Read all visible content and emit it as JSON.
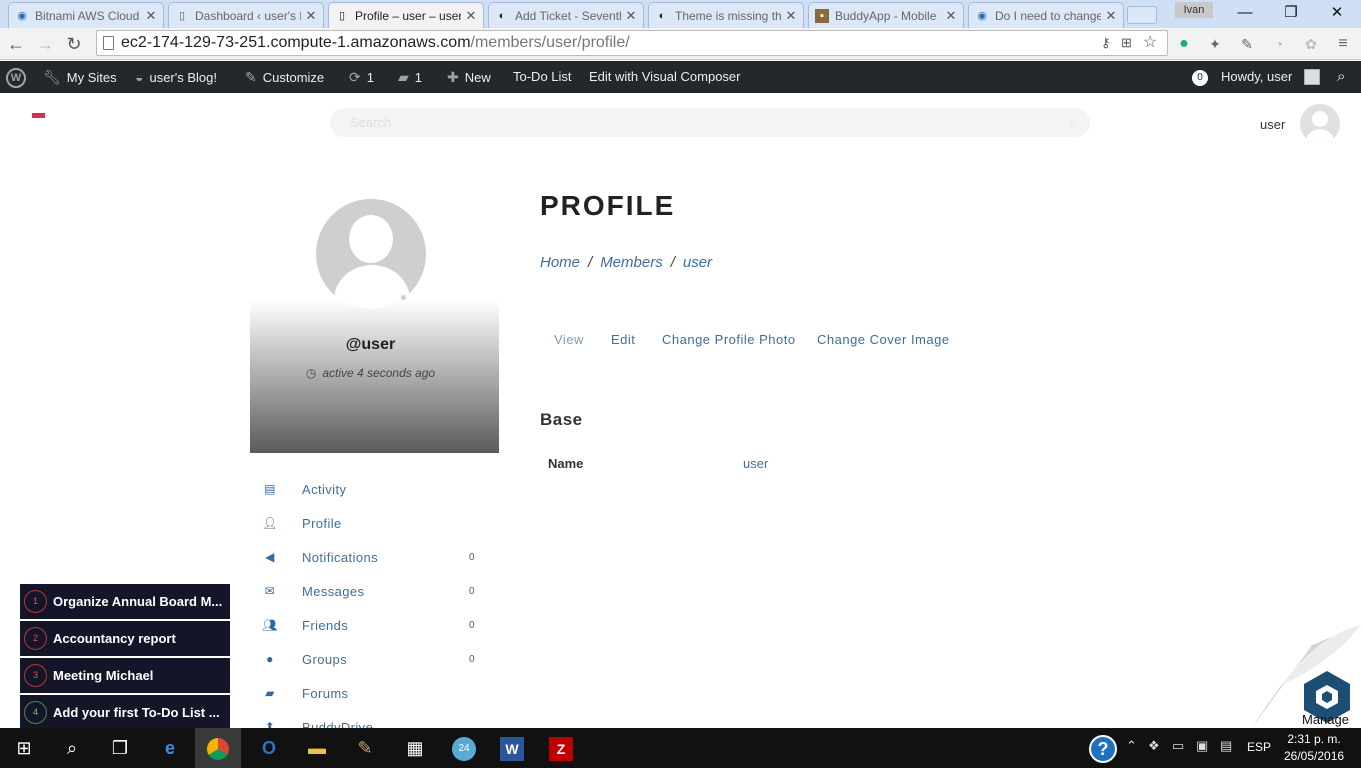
{
  "browser": {
    "tabs": [
      {
        "title": "Bitnami AWS Cloud",
        "icon": "bitnami-icon",
        "active": false
      },
      {
        "title": "Dashboard ‹ user's B",
        "icon": "page-icon",
        "active": false
      },
      {
        "title": "Profile – user – user",
        "icon": "page-icon",
        "active": true
      },
      {
        "title": "Add Ticket - Seventh",
        "icon": "theme-icon",
        "active": false
      },
      {
        "title": "Theme is missing the",
        "icon": "theme-icon",
        "active": false
      },
      {
        "title": "BuddyApp - Mobile",
        "icon": "buddyapp-icon",
        "active": false
      },
      {
        "title": "Do I need to change",
        "icon": "bitnami-icon",
        "active": false
      }
    ],
    "profile_name": "Ivan",
    "url_host": "ec2-174-129-73-251.compute-1.amazonaws.com",
    "url_path": "/members/user/profile/"
  },
  "adminbar": {
    "my_sites": "My Sites",
    "blog": "user's Blog!",
    "customize": "Customize",
    "updates": "1",
    "comments": "1",
    "new": "New",
    "todo": "To-Do List",
    "visual_composer": "Edit with Visual Composer",
    "notif_count": "0",
    "howdy": "Howdy, user"
  },
  "header": {
    "search_placeholder": "Search",
    "username": "user"
  },
  "profile": {
    "handle": "@user",
    "last_active": "active 4 seconds ago",
    "nav": [
      {
        "label": "Activity",
        "count": "",
        "icon": "activity-icon"
      },
      {
        "label": "Profile",
        "count": "",
        "icon": "profile-icon"
      },
      {
        "label": "Notifications",
        "count": "0",
        "icon": "megaphone-icon"
      },
      {
        "label": "Messages",
        "count": "0",
        "icon": "envelope-icon"
      },
      {
        "label": "Friends",
        "count": "0",
        "icon": "friends-icon"
      },
      {
        "label": "Groups",
        "count": "0",
        "icon": "groups-icon"
      },
      {
        "label": "Forums",
        "count": "",
        "icon": "forums-icon"
      },
      {
        "label": "BuddyDrive",
        "count": "",
        "icon": "upload-icon"
      }
    ]
  },
  "main": {
    "title": "PROFILE",
    "breadcrumb": [
      "Home",
      "Members",
      "user"
    ],
    "subnav": [
      "View",
      "Edit",
      "Change Profile Photo",
      "Change Cover Image"
    ],
    "section_title": "Base",
    "fields": [
      {
        "label": "Name",
        "value": "user"
      }
    ]
  },
  "todos": [
    {
      "num": "1",
      "text": "Organize Annual Board M..."
    },
    {
      "num": "2",
      "text": "Accountancy report"
    },
    {
      "num": "3",
      "text": "Meeting Michael"
    },
    {
      "num": "4",
      "text": "Add your first To-Do List ..."
    }
  ],
  "manage_label": "Manage",
  "taskbar": {
    "lang": "ESP",
    "time": "2:31 p. m.",
    "date": "26/05/2016",
    "badge_24": "24"
  },
  "colors": {
    "admin_bar": "#23282d",
    "link": "#3f6e9e",
    "logo_accent": "#e02b4e",
    "todo_bg": "#15152a"
  }
}
